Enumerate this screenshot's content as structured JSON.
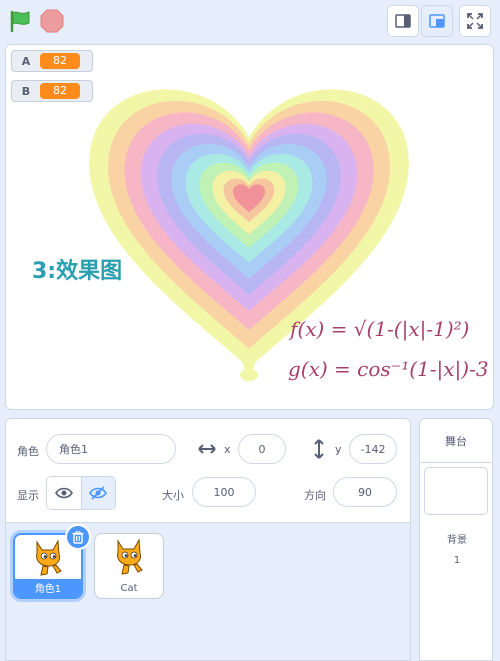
{
  "toolbar": {
    "green_flag": "green-flag-icon",
    "stop": "stop-icon",
    "small_stage": "small-stage-icon",
    "normal_stage": "normal-stage-icon",
    "fullscreen": "fullscreen-icon"
  },
  "monitors": [
    {
      "name": "A",
      "value": "82"
    },
    {
      "name": "B",
      "value": "82"
    }
  ],
  "stage": {
    "annotation_title": "3:效果图",
    "formula_f": "f(x) = √(1-(|x|-1)²)",
    "formula_g": "g(x) = cos⁻¹(1-|x|)-3"
  },
  "sprite_info": {
    "sprite_label": "角色",
    "sprite_name": "角色1",
    "x_label": "x",
    "x_value": "0",
    "y_label": "y",
    "y_value": "-142",
    "show_label": "显示",
    "size_label": "大小",
    "size_value": "100",
    "direction_label": "方向",
    "direction_value": "90"
  },
  "sprites": [
    {
      "name": "角色1",
      "selected": true
    },
    {
      "name": "Cat",
      "selected": false
    }
  ],
  "stage_panel": {
    "title": "舞台",
    "backdrops_label": "背景",
    "backdrops_count": "1"
  },
  "colors": {
    "accent": "#4c97ff",
    "monitor_value": "#ff8c1a",
    "annotation": "#2a9fb0",
    "formula": "#a83f68"
  }
}
